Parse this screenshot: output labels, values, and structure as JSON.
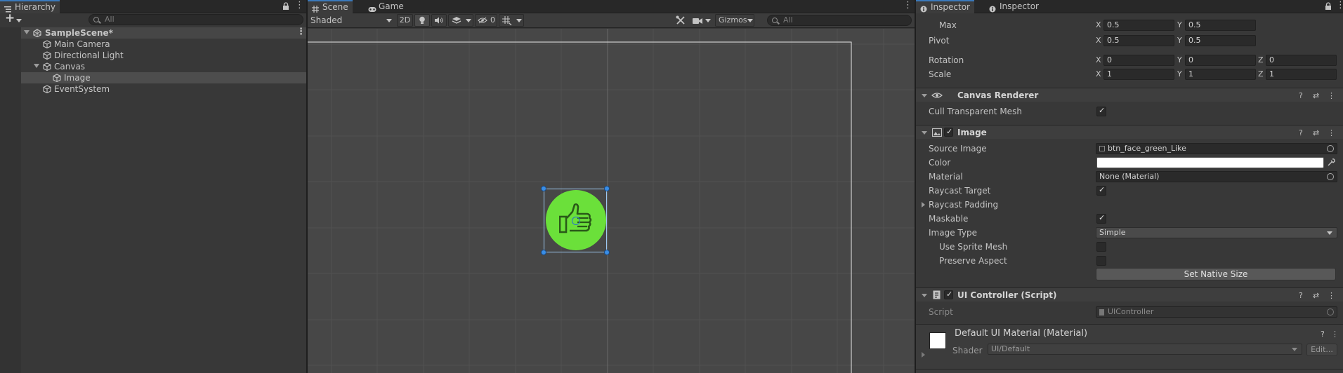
{
  "hierarchy": {
    "tab_label": "Hierarchy",
    "search_placeholder": "All",
    "add_label": "+",
    "items": [
      {
        "label": "SampleScene*"
      },
      {
        "label": "Main Camera"
      },
      {
        "label": "Directional Light"
      },
      {
        "label": "Canvas"
      },
      {
        "label": "Image"
      },
      {
        "label": "EventSystem"
      }
    ]
  },
  "scene": {
    "tabs": [
      {
        "label": "Scene"
      },
      {
        "label": "Game"
      }
    ],
    "shading_mode": "Shaded",
    "mode_2d": "2D",
    "hidden_count": "0",
    "gizmos_label": "Gizmos",
    "search_placeholder": "All"
  },
  "inspector": {
    "tabs": [
      {
        "label": "Inspector"
      },
      {
        "label": "Inspector"
      }
    ],
    "rect": {
      "max_label": "Max",
      "max_x": "0.5",
      "max_y": "0.5",
      "pivot_label": "Pivot",
      "pivot_x": "0.5",
      "pivot_y": "0.5",
      "rotation_label": "Rotation",
      "rotation_x": "0",
      "rotation_y": "0",
      "rotation_z": "0",
      "scale_label": "Scale",
      "scale_x": "1",
      "scale_y": "1",
      "scale_z": "1",
      "axis_x": "X",
      "axis_y": "Y",
      "axis_z": "Z"
    },
    "canvas_renderer": {
      "title": "Canvas Renderer",
      "cull_label": "Cull Transparent Mesh",
      "cull_checked": true
    },
    "image": {
      "title": "Image",
      "source_image_label": "Source Image",
      "source_image_value": "btn_face_green_Like",
      "color_label": "Color",
      "color_value": "#ffffff",
      "material_label": "Material",
      "material_value": "None (Material)",
      "raycast_target_label": "Raycast Target",
      "raycast_padding_label": "Raycast Padding",
      "maskable_label": "Maskable",
      "image_type_label": "Image Type",
      "image_type_value": "Simple",
      "use_sprite_mesh_label": "Use Sprite Mesh",
      "preserve_aspect_label": "Preserve Aspect",
      "set_native_size_label": "Set Native Size"
    },
    "ui_controller": {
      "title": "UI Controller (Script)",
      "script_label": "Script",
      "script_value": "UIController"
    },
    "material": {
      "title": "Default UI Material (Material)",
      "shader_label": "Shader",
      "shader_value": "UI/Default",
      "edit_label": "Edit..."
    }
  },
  "colors": {
    "accent": "#3a79bb",
    "like_button_green": "#6be03a",
    "selection_handle": "#3a8ee6"
  }
}
